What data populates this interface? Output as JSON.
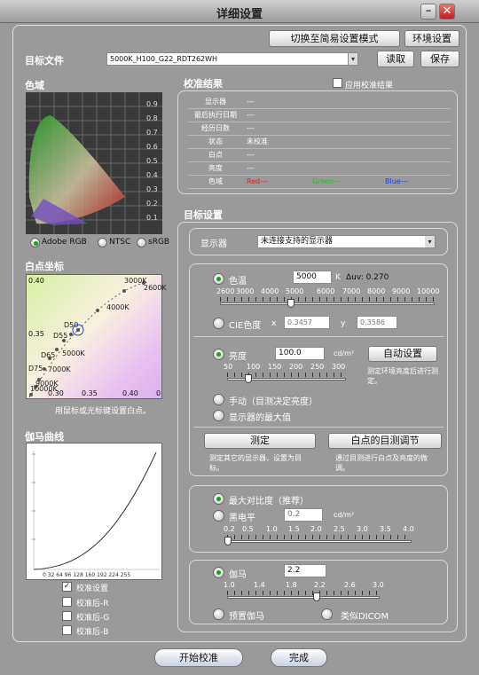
{
  "window": {
    "title": "详细设置",
    "minimize_icon": "minimize-icon",
    "close_icon": "close-icon"
  },
  "top": {
    "switch_simple_label": "切换至简易设置模式",
    "environment_label": "环境设置",
    "target_file_label": "目标文件",
    "target_file_value": "5000K_H100_G22_RDT262WH",
    "read_label": "读取",
    "save_label": "保存"
  },
  "gamut": {
    "title": "色域",
    "y_ticks": [
      "0.9",
      "0.8",
      "0.7",
      "0.6",
      "0.5",
      "0.4",
      "0.3",
      "0.2",
      "0.1"
    ],
    "options": [
      "Adobe RGB",
      "NTSC",
      "sRGB"
    ],
    "selected": "Adobe RGB"
  },
  "whitepoint": {
    "title": "白点坐标",
    "axis_labels": {
      "top_left": "0.40",
      "mid_left": "0.35",
      "bottom_left": "0.30",
      "x1": "0.35",
      "x2": "0.40",
      "x3": "0"
    },
    "points": [
      "3000K",
      "2600K",
      "4000K",
      "D50",
      "D55",
      "5000K",
      "D65",
      "7000K",
      "D75",
      "9000K",
      "10000K"
    ],
    "hint": "用鼠标或光标键设置白点。"
  },
  "gamma_curve": {
    "title": "伽马曲线",
    "x_ticks": [
      "0",
      "32",
      "64",
      "96",
      "128",
      "160",
      "192",
      "224",
      "255"
    ],
    "checks": [
      {
        "label": "校准设置",
        "checked": true
      },
      {
        "label": "校准后-R",
        "checked": false
      },
      {
        "label": "校准后-G",
        "checked": false
      },
      {
        "label": "校准后-B",
        "checked": false
      }
    ]
  },
  "results": {
    "title": "校准结果",
    "apply_label": "应用校准结果",
    "rows": [
      {
        "label": "显示器",
        "value": "---"
      },
      {
        "label": "最后执行日期",
        "value": "---"
      },
      {
        "label": "经历日数",
        "value": "---"
      },
      {
        "label": "状态",
        "value": "未校准"
      },
      {
        "label": "白点",
        "value": "---"
      },
      {
        "label": "亮度",
        "value": "---"
      }
    ],
    "gamut_row": {
      "label": "色域",
      "red": "Red---",
      "green": "Green---",
      "blue": "Blue---"
    },
    "colors": {
      "red": "#e02020",
      "green": "#20c020",
      "blue": "#2040e0"
    }
  },
  "target": {
    "title": "目标设置",
    "monitor_label": "显示器",
    "monitor_value": "未连接支持的显示器",
    "color_temp_label": "色温",
    "color_temp_value": "5000",
    "color_temp_unit": "K",
    "duv_label": "Δuv: 0.270",
    "temp_ticks": [
      "2600",
      "3000",
      "4000",
      "5000",
      "6000",
      "7000",
      "8000",
      "9000",
      "10000"
    ],
    "cie_label": "CIE色度",
    "cie_x_label": "x",
    "cie_x_value": "0.3457",
    "cie_y_label": "y",
    "cie_y_value": "0.3586",
    "brightness_label": "亮度",
    "brightness_value": "100.0",
    "brightness_unit": "cd/m²",
    "auto_setting_label": "自动设置",
    "auto_note": "测定环境亮度后进行测定。",
    "brightness_ticks": [
      "50",
      "100",
      "150",
      "200",
      "250",
      "300"
    ],
    "manual_label": "手动（目测决定亮度）",
    "max_label": "显示器的最大值",
    "measure_label": "测定",
    "measure_note": "测定其它的显示器，设置为目标。",
    "visual_adjust_label": "白点的目测调节",
    "visual_note": "通过目测进行白点及亮度的微调。",
    "max_contrast_label": "最大对比度（推荐）",
    "black_level_label": "黑电平",
    "black_level_value": "0.2",
    "black_level_unit": "cd/m²",
    "black_ticks": [
      "0.2",
      "0.5",
      "1.0",
      "1.5",
      "2.0",
      "2.5",
      "3.0",
      "3.5",
      "4.0"
    ],
    "gamma_label": "伽马",
    "gamma_value": "2.2",
    "gamma_ticks": [
      "1.0",
      "1.4",
      "1.8",
      "2.2",
      "2.6",
      "3.0"
    ],
    "preset_gamma_label": "预置伽马",
    "dicom_label": "类似DICOM"
  },
  "bottom": {
    "start_label": "开始校准",
    "done_label": "完成"
  }
}
